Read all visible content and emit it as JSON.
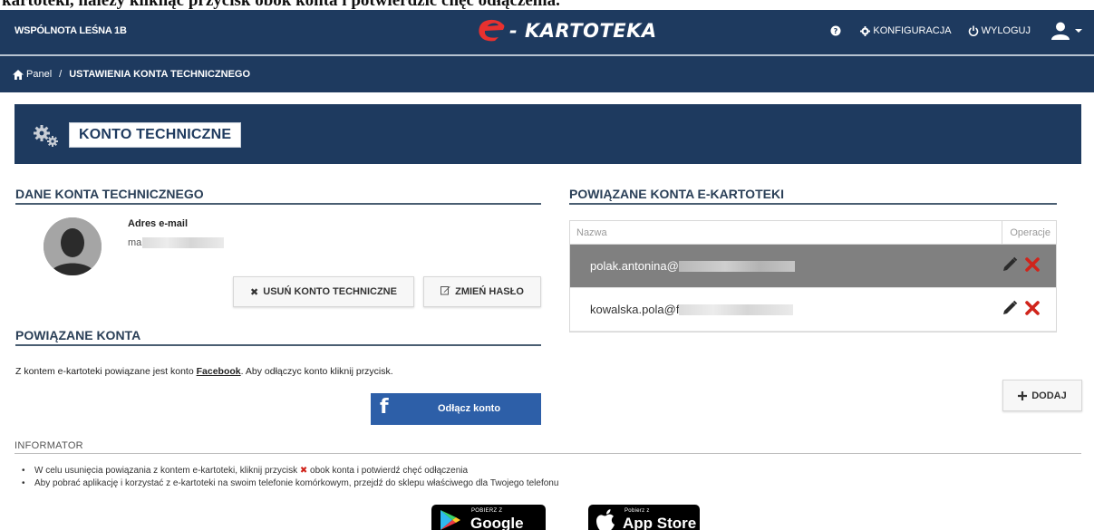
{
  "top_cut_text": "kartoteki, należy kliknąć przycisk obok konta i potwierdzić chęć odłączenia.",
  "navbar": {
    "org_name": "WSPÓLNOTA LEŚNA 1B",
    "logo_text": "- KARTOTEKA",
    "config_label": "KONFIGURACJA",
    "logout_label": "WYLOGUJ"
  },
  "breadcrumb": {
    "home": "Panel",
    "separator": "/",
    "current": "USTAWIENIA KONTA TECHNICZNEGO"
  },
  "panel": {
    "title": "KONTO TECHNICZNE"
  },
  "account": {
    "section_title": "DANE KONTA TECHNICZNEGO",
    "email_label": "Adres e-mail",
    "email_value_visible": "ma",
    "delete_button": "USUŃ KONTO TECHNICZNE",
    "change_password_button": "ZMIEŃ HASŁO"
  },
  "linked": {
    "section_title": "POWIĄZANE KONTA",
    "text_before": "Z kontem e-kartoteki powiązane jest konto ",
    "provider": "Facebook",
    "text_after": ". Aby odłączyc konto kliknij przycisk.",
    "disconnect_button": "Odłącz konto",
    "fb_glyph": "f"
  },
  "ekartoteka_accounts": {
    "section_title": "POWIĄZANE KONTA E-KARTOTEKI",
    "col_name": "Nazwa",
    "col_ops": "Operacje",
    "rows": [
      {
        "email_visible": "polak.antonina@",
        "selected": true
      },
      {
        "email_visible": "kowalska.pola@f",
        "selected": false
      }
    ],
    "add_button": "DODAJ"
  },
  "informator": {
    "title": "INFORMATOR",
    "item1_before": "W celu usunięcia powiązania z kontem e-kartoteki, kliknij przycisk ",
    "item1_after": " obok konta i potwierdź chęć odłączenia",
    "item2": "Aby pobrać aplikację i korzystać z e-kartoteki na swoim telefonie komórkowym, przejdź do sklepu właściwego dla Twojego telefonu"
  },
  "stores": {
    "google_small": "POBIERZ Z",
    "google_big": "Google Play",
    "apple_small": "Pobierz z",
    "apple_big": "App Store"
  },
  "colors": {
    "navy": "#1e3a5f",
    "logo_red": "#e8312f",
    "delete_red": "#d0241b",
    "facebook_blue": "#2d5fa8",
    "selected_row": "#808080"
  }
}
